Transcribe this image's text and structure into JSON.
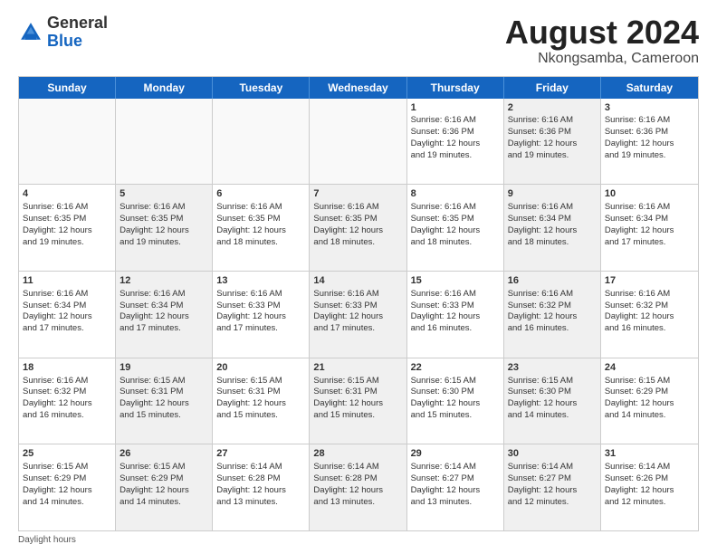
{
  "header": {
    "logo_general": "General",
    "logo_blue": "Blue",
    "main_title": "August 2024",
    "subtitle": "Nkongsamba, Cameroon"
  },
  "calendar": {
    "days_of_week": [
      "Sunday",
      "Monday",
      "Tuesday",
      "Wednesday",
      "Thursday",
      "Friday",
      "Saturday"
    ],
    "weeks": [
      [
        {
          "day": "",
          "info": "",
          "empty": true
        },
        {
          "day": "",
          "info": "",
          "empty": true
        },
        {
          "day": "",
          "info": "",
          "empty": true
        },
        {
          "day": "",
          "info": "",
          "empty": true
        },
        {
          "day": "1",
          "info": "Sunrise: 6:16 AM\nSunset: 6:36 PM\nDaylight: 12 hours\nand 19 minutes.",
          "empty": false,
          "shaded": false
        },
        {
          "day": "2",
          "info": "Sunrise: 6:16 AM\nSunset: 6:36 PM\nDaylight: 12 hours\nand 19 minutes.",
          "empty": false,
          "shaded": true
        },
        {
          "day": "3",
          "info": "Sunrise: 6:16 AM\nSunset: 6:36 PM\nDaylight: 12 hours\nand 19 minutes.",
          "empty": false,
          "shaded": false
        }
      ],
      [
        {
          "day": "4",
          "info": "Sunrise: 6:16 AM\nSunset: 6:35 PM\nDaylight: 12 hours\nand 19 minutes.",
          "empty": false,
          "shaded": false
        },
        {
          "day": "5",
          "info": "Sunrise: 6:16 AM\nSunset: 6:35 PM\nDaylight: 12 hours\nand 19 minutes.",
          "empty": false,
          "shaded": true
        },
        {
          "day": "6",
          "info": "Sunrise: 6:16 AM\nSunset: 6:35 PM\nDaylight: 12 hours\nand 18 minutes.",
          "empty": false,
          "shaded": false
        },
        {
          "day": "7",
          "info": "Sunrise: 6:16 AM\nSunset: 6:35 PM\nDaylight: 12 hours\nand 18 minutes.",
          "empty": false,
          "shaded": true
        },
        {
          "day": "8",
          "info": "Sunrise: 6:16 AM\nSunset: 6:35 PM\nDaylight: 12 hours\nand 18 minutes.",
          "empty": false,
          "shaded": false
        },
        {
          "day": "9",
          "info": "Sunrise: 6:16 AM\nSunset: 6:34 PM\nDaylight: 12 hours\nand 18 minutes.",
          "empty": false,
          "shaded": true
        },
        {
          "day": "10",
          "info": "Sunrise: 6:16 AM\nSunset: 6:34 PM\nDaylight: 12 hours\nand 17 minutes.",
          "empty": false,
          "shaded": false
        }
      ],
      [
        {
          "day": "11",
          "info": "Sunrise: 6:16 AM\nSunset: 6:34 PM\nDaylight: 12 hours\nand 17 minutes.",
          "empty": false,
          "shaded": false
        },
        {
          "day": "12",
          "info": "Sunrise: 6:16 AM\nSunset: 6:34 PM\nDaylight: 12 hours\nand 17 minutes.",
          "empty": false,
          "shaded": true
        },
        {
          "day": "13",
          "info": "Sunrise: 6:16 AM\nSunset: 6:33 PM\nDaylight: 12 hours\nand 17 minutes.",
          "empty": false,
          "shaded": false
        },
        {
          "day": "14",
          "info": "Sunrise: 6:16 AM\nSunset: 6:33 PM\nDaylight: 12 hours\nand 17 minutes.",
          "empty": false,
          "shaded": true
        },
        {
          "day": "15",
          "info": "Sunrise: 6:16 AM\nSunset: 6:33 PM\nDaylight: 12 hours\nand 16 minutes.",
          "empty": false,
          "shaded": false
        },
        {
          "day": "16",
          "info": "Sunrise: 6:16 AM\nSunset: 6:32 PM\nDaylight: 12 hours\nand 16 minutes.",
          "empty": false,
          "shaded": true
        },
        {
          "day": "17",
          "info": "Sunrise: 6:16 AM\nSunset: 6:32 PM\nDaylight: 12 hours\nand 16 minutes.",
          "empty": false,
          "shaded": false
        }
      ],
      [
        {
          "day": "18",
          "info": "Sunrise: 6:16 AM\nSunset: 6:32 PM\nDaylight: 12 hours\nand 16 minutes.",
          "empty": false,
          "shaded": false
        },
        {
          "day": "19",
          "info": "Sunrise: 6:15 AM\nSunset: 6:31 PM\nDaylight: 12 hours\nand 15 minutes.",
          "empty": false,
          "shaded": true
        },
        {
          "day": "20",
          "info": "Sunrise: 6:15 AM\nSunset: 6:31 PM\nDaylight: 12 hours\nand 15 minutes.",
          "empty": false,
          "shaded": false
        },
        {
          "day": "21",
          "info": "Sunrise: 6:15 AM\nSunset: 6:31 PM\nDaylight: 12 hours\nand 15 minutes.",
          "empty": false,
          "shaded": true
        },
        {
          "day": "22",
          "info": "Sunrise: 6:15 AM\nSunset: 6:30 PM\nDaylight: 12 hours\nand 15 minutes.",
          "empty": false,
          "shaded": false
        },
        {
          "day": "23",
          "info": "Sunrise: 6:15 AM\nSunset: 6:30 PM\nDaylight: 12 hours\nand 14 minutes.",
          "empty": false,
          "shaded": true
        },
        {
          "day": "24",
          "info": "Sunrise: 6:15 AM\nSunset: 6:29 PM\nDaylight: 12 hours\nand 14 minutes.",
          "empty": false,
          "shaded": false
        }
      ],
      [
        {
          "day": "25",
          "info": "Sunrise: 6:15 AM\nSunset: 6:29 PM\nDaylight: 12 hours\nand 14 minutes.",
          "empty": false,
          "shaded": false
        },
        {
          "day": "26",
          "info": "Sunrise: 6:15 AM\nSunset: 6:29 PM\nDaylight: 12 hours\nand 14 minutes.",
          "empty": false,
          "shaded": true
        },
        {
          "day": "27",
          "info": "Sunrise: 6:14 AM\nSunset: 6:28 PM\nDaylight: 12 hours\nand 13 minutes.",
          "empty": false,
          "shaded": false
        },
        {
          "day": "28",
          "info": "Sunrise: 6:14 AM\nSunset: 6:28 PM\nDaylight: 12 hours\nand 13 minutes.",
          "empty": false,
          "shaded": true
        },
        {
          "day": "29",
          "info": "Sunrise: 6:14 AM\nSunset: 6:27 PM\nDaylight: 12 hours\nand 13 minutes.",
          "empty": false,
          "shaded": false
        },
        {
          "day": "30",
          "info": "Sunrise: 6:14 AM\nSunset: 6:27 PM\nDaylight: 12 hours\nand 12 minutes.",
          "empty": false,
          "shaded": true
        },
        {
          "day": "31",
          "info": "Sunrise: 6:14 AM\nSunset: 6:26 PM\nDaylight: 12 hours\nand 12 minutes.",
          "empty": false,
          "shaded": false
        }
      ]
    ]
  },
  "footer": {
    "note": "Daylight hours"
  }
}
